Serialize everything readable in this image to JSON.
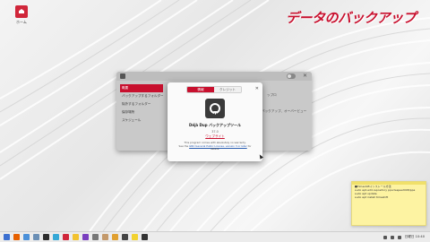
{
  "desktop": {
    "icon_label": "ホーム"
  },
  "banner": "データのバックアップ",
  "settings_window": {
    "sidebar": [
      "概要",
      "バックアップするフォルダー",
      "除外するフォルダー",
      "保存場所",
      "スケジュール"
    ],
    "body_texts": [
      "ップロ",
      "バックアップ、オーバービュー"
    ]
  },
  "about": {
    "tabs": [
      "情報",
      "クレジット"
    ],
    "app_name": "Déjà Dup バックアップツール",
    "version": "37.0",
    "website": "ウェブサイト",
    "license_line1": "This program comes with absolutely no warranty.",
    "license_line2_prefix": "See the ",
    "license_link": "GNU General Public License, version 3 or later",
    "license_line2_suffix": " for details."
  },
  "sticky_note": {
    "lines": [
      "■Timeshiftインストール方法",
      "sudo apt-add-repository ppa:teejee2008/ppa",
      "sudo apt update",
      "sudo apt install timeshift"
    ]
  },
  "taskbar": {
    "icons": [
      {
        "name": "menu-icon",
        "color": "#3b6fd0"
      },
      {
        "name": "firefox-icon",
        "color": "#e66000"
      },
      {
        "name": "files-icon",
        "color": "#4a90d9"
      },
      {
        "name": "folder-icon",
        "color": "#6b8fb5"
      },
      {
        "name": "terminal-icon",
        "color": "#2e2e2e"
      },
      {
        "name": "software-icon",
        "color": "#35a8d6"
      },
      {
        "name": "record-icon",
        "color": "#d0263a"
      },
      {
        "name": "notes-icon",
        "color": "#f2c230"
      },
      {
        "name": "store-icon",
        "color": "#7a3fbf"
      },
      {
        "name": "settings-icon",
        "color": "#777777"
      },
      {
        "name": "image-icon",
        "color": "#c49a6c"
      },
      {
        "name": "music-icon",
        "color": "#e0a030"
      },
      {
        "name": "calendar-icon",
        "color": "#444444"
      },
      {
        "name": "sticky-icon",
        "color": "#f2d230"
      },
      {
        "name": "backup-icon",
        "color": "#333333"
      }
    ],
    "clock": "日曜日 10:40"
  }
}
